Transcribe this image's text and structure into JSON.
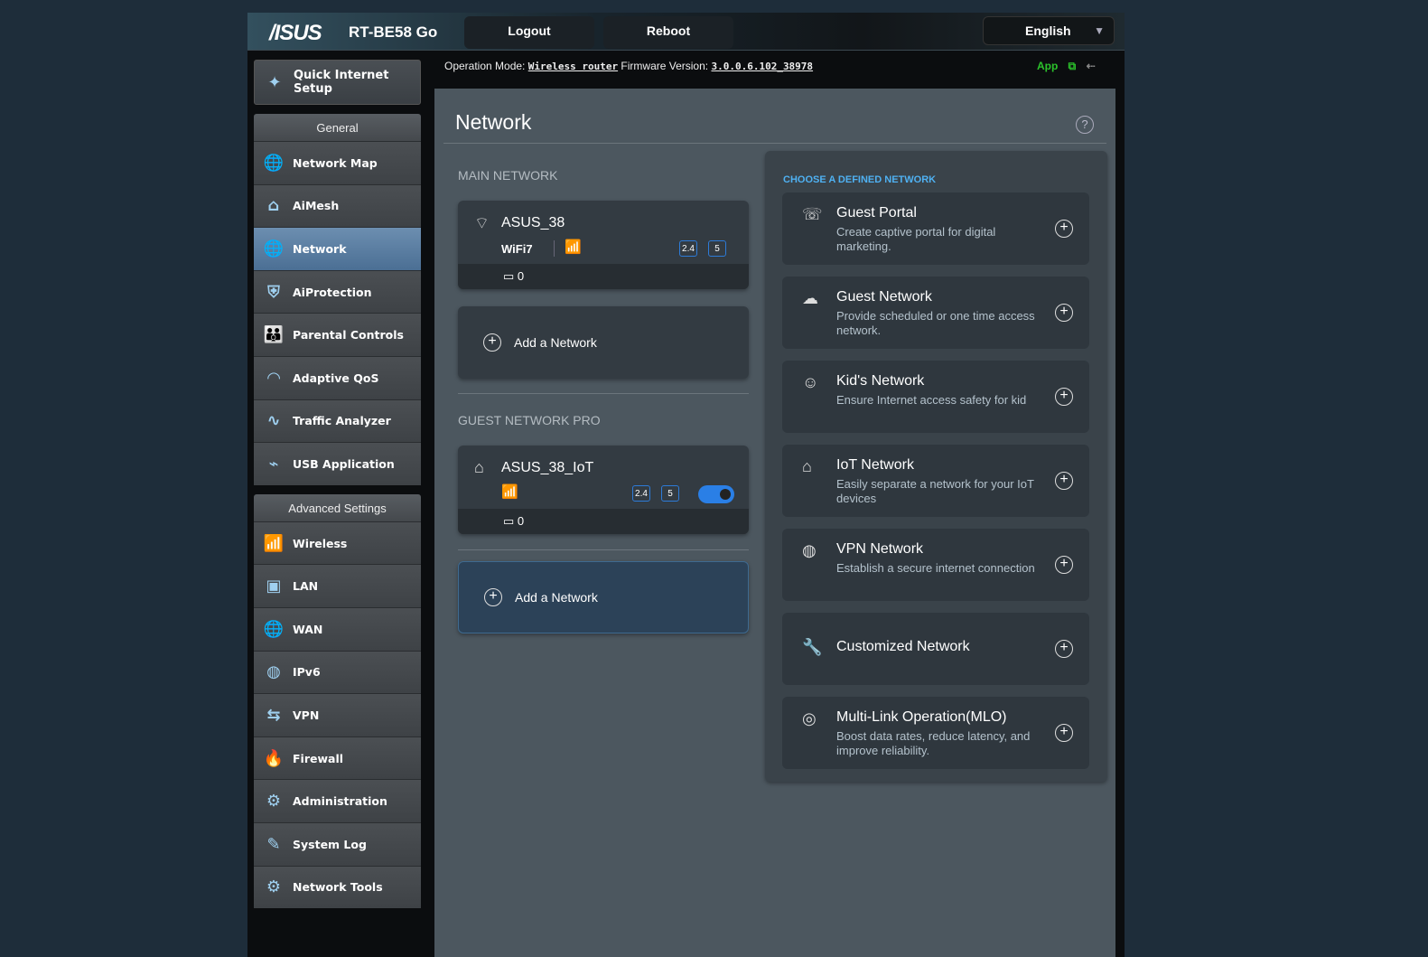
{
  "header": {
    "logo": "/ISUS",
    "model": "RT-BE58 Go",
    "logout": "Logout",
    "reboot": "Reboot",
    "language": "English",
    "op_mode_label": "Operation Mode:",
    "op_mode": "Wireless router",
    "fw_label": "Firmware Version:",
    "fw": "3.0.0.6.102_38978",
    "app": "App"
  },
  "sidebar": {
    "qis": "Quick Internet Setup",
    "general": "General",
    "general_items": [
      "Network Map",
      "AiMesh",
      "Network",
      "AiProtection",
      "Parental Controls",
      "Adaptive QoS",
      "Traffic Analyzer",
      "USB Application"
    ],
    "advanced": "Advanced Settings",
    "advanced_items": [
      "Wireless",
      "LAN",
      "WAN",
      "IPv6",
      "VPN",
      "Firewall",
      "Administration",
      "System Log",
      "Network Tools"
    ]
  },
  "main": {
    "title": "Network",
    "main_label": "MAIN NETWORK",
    "guest_label": "GUEST NETWORK PRO",
    "main_net": {
      "ssid": "ASUS_38",
      "wifi7": "WiFi7",
      "band1": "2.4",
      "band2": "5",
      "clients": "0"
    },
    "guest_net": {
      "ssid": "ASUS_38_IoT",
      "band1": "2.4",
      "band2": "5",
      "clients": "0",
      "enabled": true
    },
    "add": "Add a Network",
    "choose_label": "CHOOSE A DEFINED NETWORK",
    "defined": [
      {
        "title": "Guest Portal",
        "desc": "Create captive portal for digital marketing."
      },
      {
        "title": "Guest Network",
        "desc": "Provide scheduled or one time access network."
      },
      {
        "title": "Kid's Network",
        "desc": "Ensure Internet access safety for kid"
      },
      {
        "title": "IoT Network",
        "desc": "Easily separate a network for your IoT devices"
      },
      {
        "title": "VPN Network",
        "desc": "Establish a secure internet connection"
      },
      {
        "title": "Customized Network",
        "desc": ""
      },
      {
        "title": "Multi-Link Operation(MLO)",
        "desc": "Boost data rates, reduce latency, and improve reliability."
      }
    ]
  }
}
